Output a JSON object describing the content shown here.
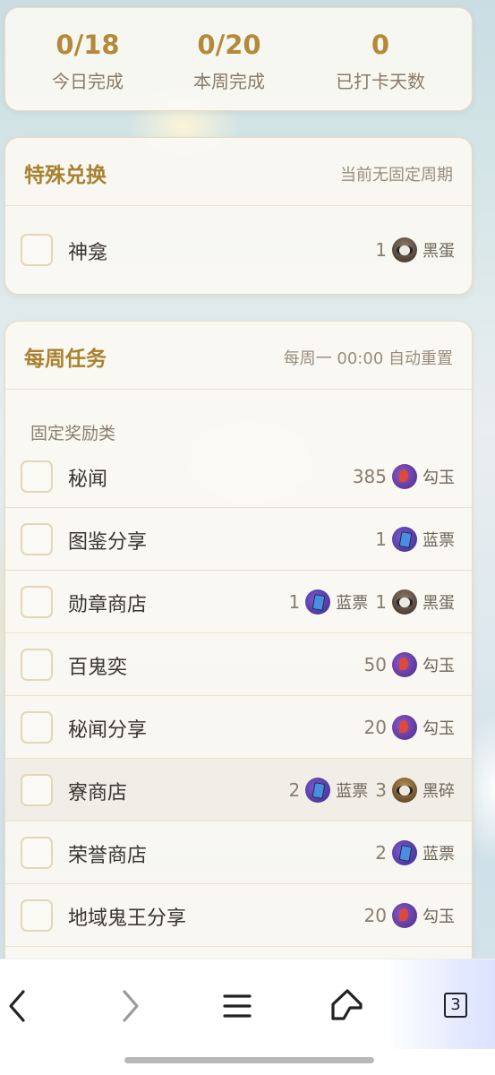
{
  "stats": [
    {
      "value": "0/18",
      "label": "今日完成"
    },
    {
      "value": "0/20",
      "label": "本周完成"
    },
    {
      "value": "0",
      "label": "已打卡天数"
    }
  ],
  "special": {
    "title": "特殊兑换",
    "note": "当前无固定周期",
    "items": [
      {
        "name": "神龛",
        "rewards": [
          {
            "qty": "1",
            "icon": "heidan-icon",
            "name": "黑蛋"
          }
        ]
      }
    ]
  },
  "weekly": {
    "title": "每周任务",
    "note": "每周一 00:00 自动重置",
    "subhead": "固定奖励类",
    "items": [
      {
        "name": "秘闻",
        "rewards": [
          {
            "qty": "385",
            "icon": "gouyu-icon",
            "name": "勾玉"
          }
        ]
      },
      {
        "name": "图鉴分享",
        "rewards": [
          {
            "qty": "1",
            "icon": "lanpiao-icon",
            "name": "蓝票"
          }
        ]
      },
      {
        "name": "勋章商店",
        "rewards": [
          {
            "qty": "1",
            "icon": "lanpiao-icon",
            "name": "蓝票"
          },
          {
            "qty": "1",
            "icon": "heidan-icon",
            "name": "黑蛋"
          }
        ]
      },
      {
        "name": "百鬼奕",
        "rewards": [
          {
            "qty": "50",
            "icon": "gouyu-icon",
            "name": "勾玉"
          }
        ]
      },
      {
        "name": "秘闻分享",
        "rewards": [
          {
            "qty": "20",
            "icon": "gouyu-icon",
            "name": "勾玉"
          }
        ]
      },
      {
        "name": "寮商店",
        "rewards": [
          {
            "qty": "2",
            "icon": "lanpiao-icon",
            "name": "蓝票"
          },
          {
            "qty": "3",
            "icon": "heisui-icon",
            "name": "黑碎"
          }
        ]
      },
      {
        "name": "荣誉商店",
        "rewards": [
          {
            "qty": "2",
            "icon": "lanpiao-icon",
            "name": "蓝票"
          }
        ]
      },
      {
        "name": "地域鬼王分享",
        "rewards": [
          {
            "qty": "20",
            "icon": "gouyu-icon",
            "name": "勾玉"
          }
        ]
      }
    ]
  },
  "browser_nav": {
    "back_icon": "back-arrow-icon",
    "forward_icon": "forward-arrow-icon",
    "menu_icon": "menu-icon",
    "home_icon": "home-icon",
    "tab_count": "3"
  }
}
